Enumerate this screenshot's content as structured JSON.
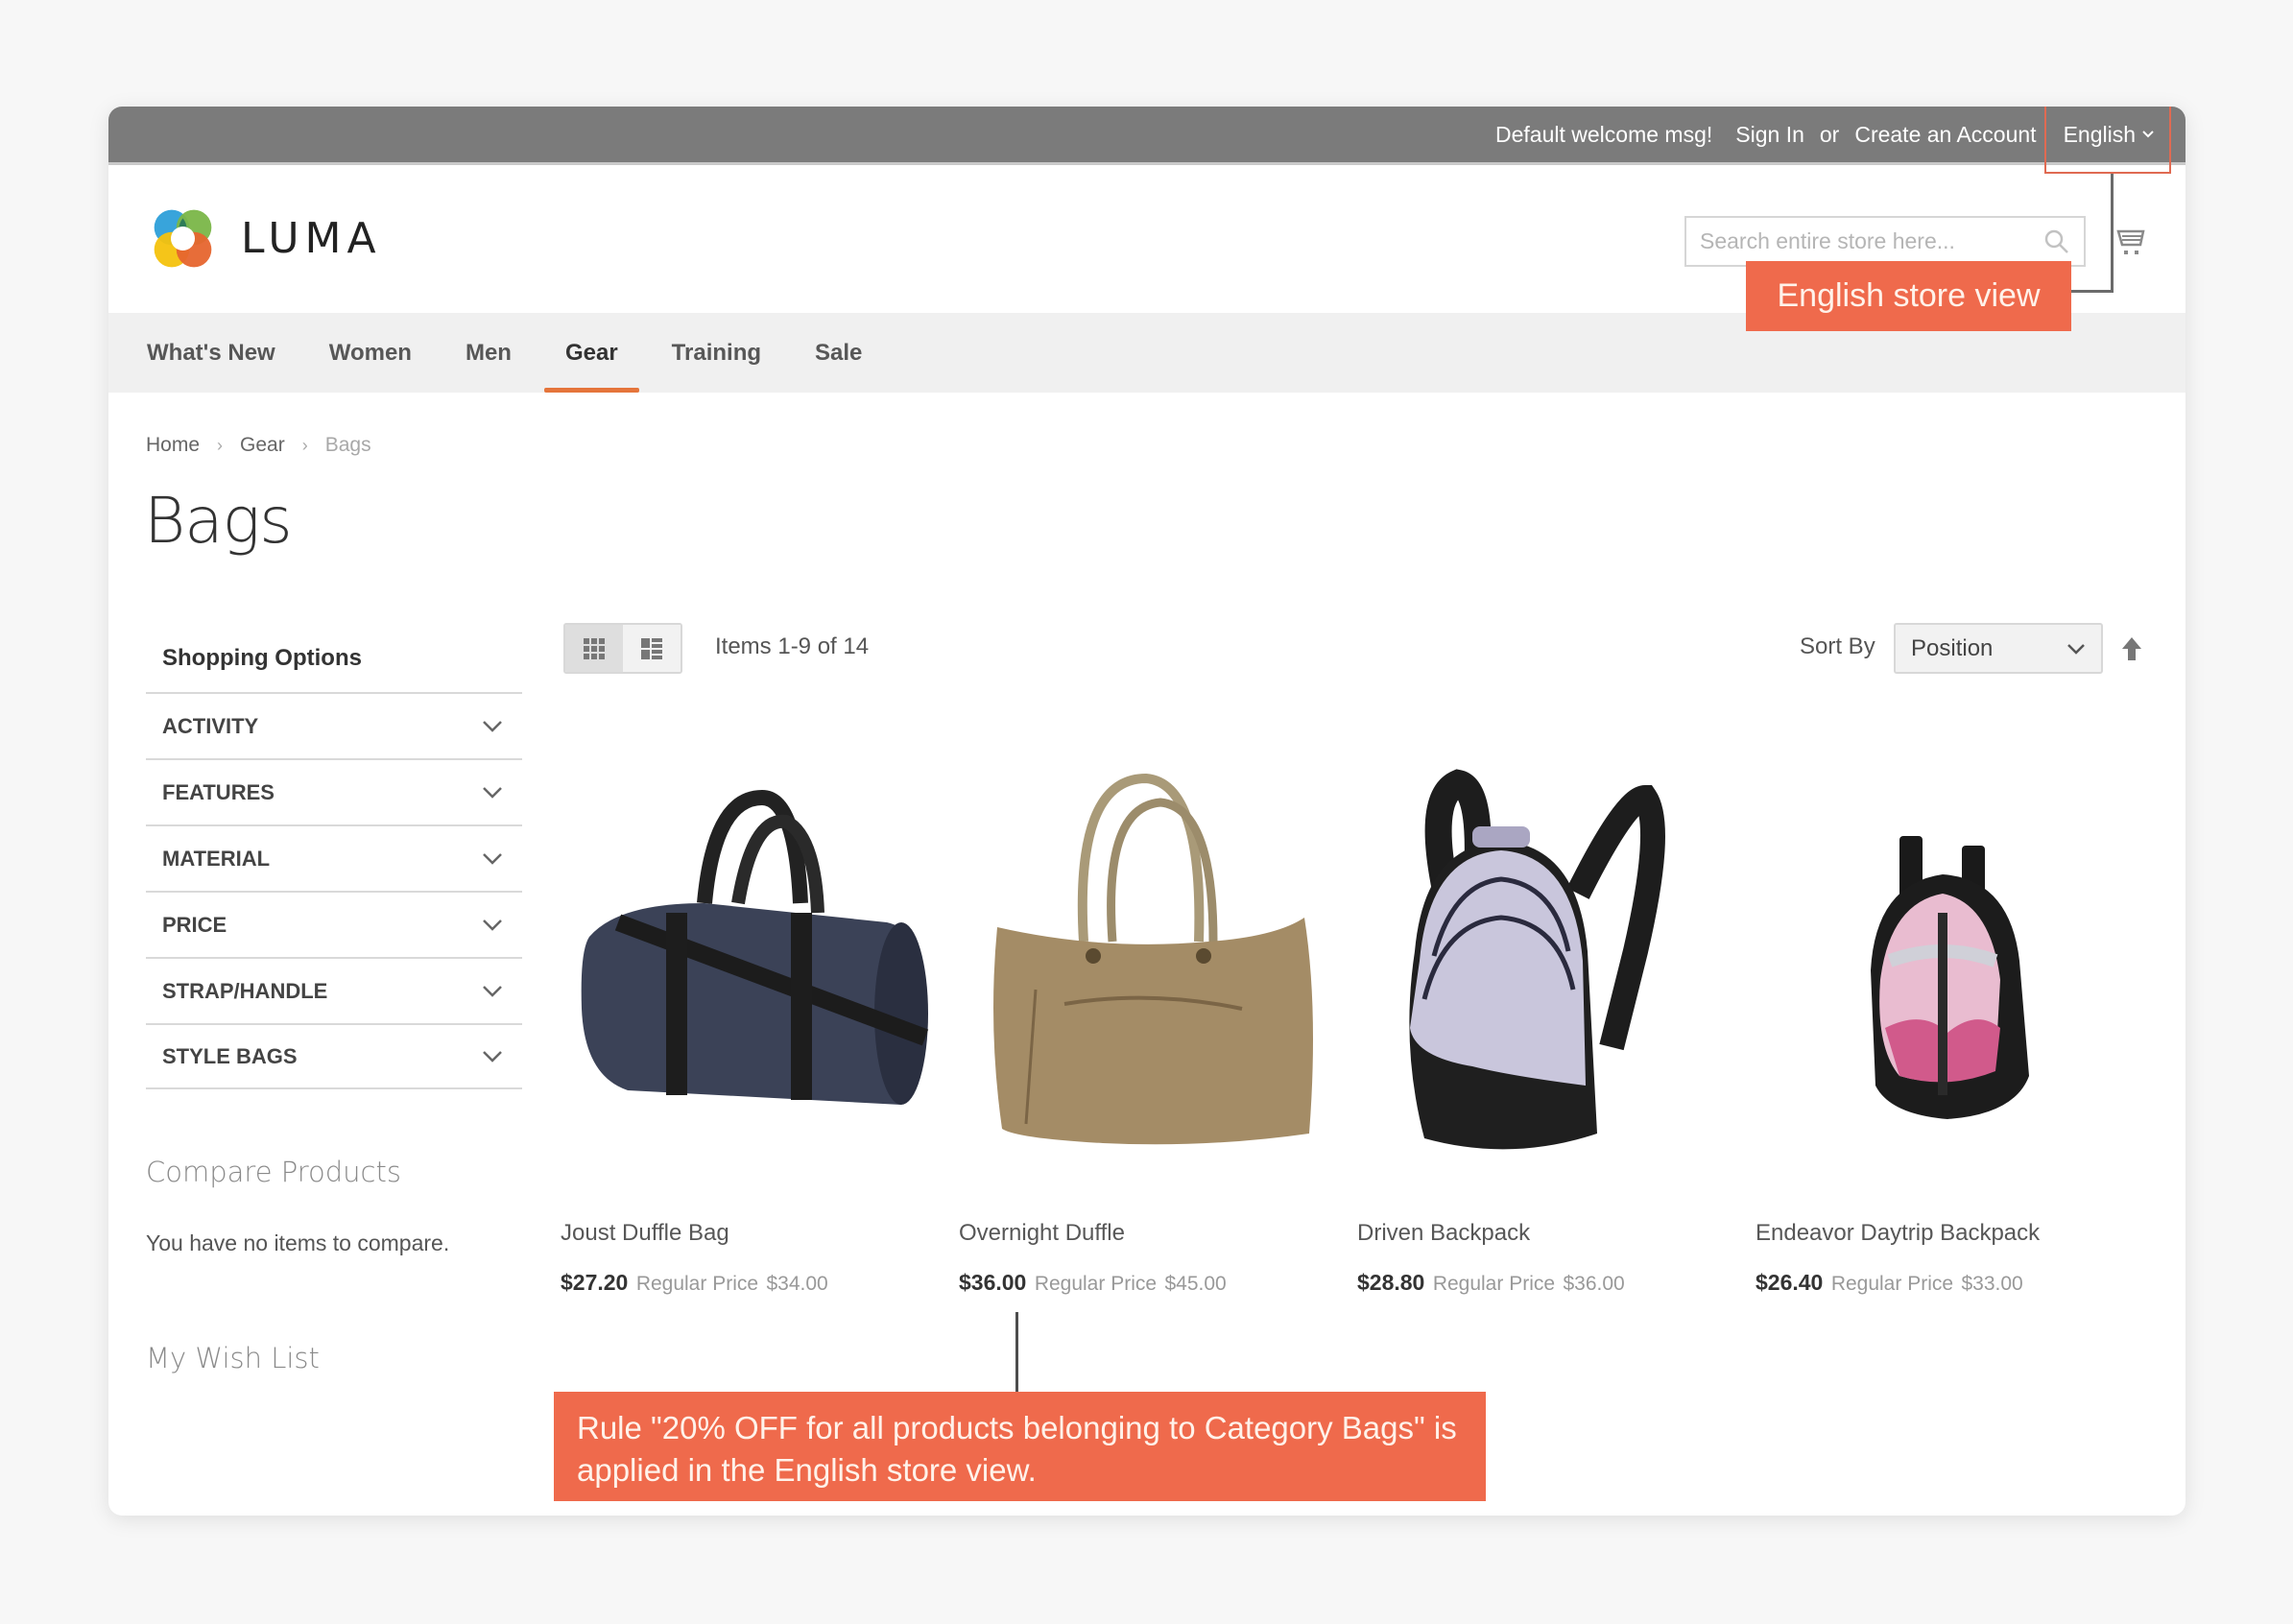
{
  "topbar": {
    "welcome": "Default welcome msg!",
    "sign_in": "Sign In",
    "or": "or",
    "create_account": "Create an Account",
    "language": "English"
  },
  "header": {
    "logo_text": "LUMA",
    "search_placeholder": "Search entire store here...",
    "icons": {
      "search": "search-icon",
      "cart": "cart-icon"
    }
  },
  "nav": {
    "items": [
      {
        "label": "What's New",
        "active": false
      },
      {
        "label": "Women",
        "active": false
      },
      {
        "label": "Men",
        "active": false
      },
      {
        "label": "Gear",
        "active": true
      },
      {
        "label": "Training",
        "active": false
      },
      {
        "label": "Sale",
        "active": false
      }
    ]
  },
  "breadcrumb": {
    "items": [
      "Home",
      "Gear",
      "Bags"
    ],
    "separator": "›"
  },
  "page_title": "Bags",
  "sidebar": {
    "title": "Shopping Options",
    "filters": [
      "ACTIVITY",
      "FEATURES",
      "MATERIAL",
      "PRICE",
      "STRAP/HANDLE",
      "STYLE BAGS"
    ],
    "compare_title": "Compare Products",
    "compare_empty": "You have no items to compare.",
    "wishlist_title": "My Wish List"
  },
  "toolbar": {
    "view_modes": [
      {
        "name": "grid",
        "active": true
      },
      {
        "name": "list",
        "active": false
      }
    ],
    "items_count": "Items 1-9 of 14",
    "sort_label": "Sort By",
    "sort_value": "Position",
    "sort_direction": "ascending"
  },
  "products": [
    {
      "name": "Joust Duffle Bag",
      "final_price": "$27.20",
      "regular_label": "Regular Price",
      "regular_price": "$34.00",
      "image": "navy duffle bag"
    },
    {
      "name": "Overnight Duffle",
      "final_price": "$36.00",
      "regular_label": "Regular Price",
      "regular_price": "$45.00",
      "image": "tan tote duffle"
    },
    {
      "name": "Driven Backpack",
      "final_price": "$28.80",
      "regular_label": "Regular Price",
      "regular_price": "$36.00",
      "image": "lavender and black backpack"
    },
    {
      "name": "Endeavor Daytrip Backpack",
      "final_price": "$26.40",
      "regular_label": "Regular Price",
      "regular_price": "$33.00",
      "image": "pink and black backpack"
    }
  ],
  "annotations": {
    "store_view": "English store view",
    "rule": "Rule \"20% OFF for all products belonging to Category Bags\" is applied in the English store view."
  },
  "colors": {
    "topbar": "#7b7b7b",
    "nav_active": "#e5753b",
    "callout": "#ef6a4c"
  }
}
